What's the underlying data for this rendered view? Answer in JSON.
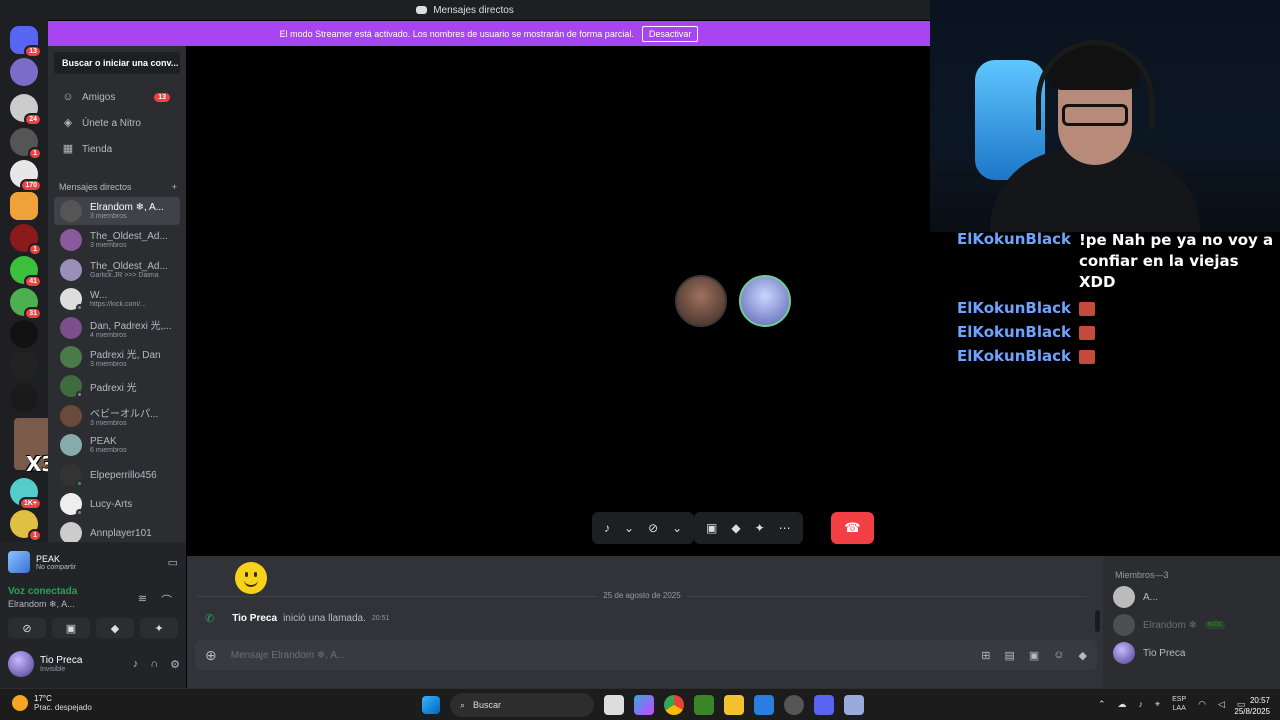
{
  "window": {
    "title": "Mensajes directos"
  },
  "banner": {
    "text": "El modo Streamer está activado. Los nombres de usuario se mostrarán de forma parcial.",
    "button": "Desactivar"
  },
  "rail": {
    "badges": [
      "13",
      "24",
      "1",
      "170",
      "1",
      "41",
      "31",
      "1K+",
      "1"
    ],
    "overlay_label": "X3"
  },
  "sidebar": {
    "search_placeholder": "Buscar o iniciar una conv...",
    "nav": [
      {
        "label": "Amigos",
        "count": "13"
      },
      {
        "label": "Únete a Nitro"
      },
      {
        "label": "Tienda"
      }
    ],
    "dm_header": "Mensajes directos",
    "dms": [
      {
        "name": "Elrandom ❄, A...",
        "sub": "3 miembros"
      },
      {
        "name": "The_Oldest_Ad...",
        "sub": "3 miembros"
      },
      {
        "name": "The_Oldest_Ad...",
        "sub": "Garlick.JR >>> Daima"
      },
      {
        "name": "W...",
        "sub": "https://kick.com/..."
      },
      {
        "name": "Dan, Padrexi 光,...",
        "sub": "4 miembros"
      },
      {
        "name": "Padrexi 光, Dan",
        "sub": "3 miembros"
      },
      {
        "name": "Padrexi 光",
        "sub": ""
      },
      {
        "name": "ベビーオルパ...",
        "sub": "3 miembros"
      },
      {
        "name": "PEAK",
        "sub": "6 miembros"
      },
      {
        "name": "Elpeperrillo456",
        "sub": ""
      },
      {
        "name": "Lucy-Arts",
        "sub": ""
      },
      {
        "name": "Annplayer101",
        "sub": ""
      }
    ]
  },
  "activity": {
    "game": "PEAK",
    "status": "No compartir"
  },
  "voice": {
    "status": "Voz conectada",
    "channel": "Elrandom ❄, A..."
  },
  "user": {
    "name": "Tio Preca",
    "status": "Invisible"
  },
  "chat": {
    "date": "25 de agosto de 2025",
    "call_user": "Tio Preca",
    "call_text": "inició una llamada.",
    "call_time": "20:51",
    "input_placeholder": "Mensaje Elrandom ❄, A..."
  },
  "members": {
    "header": "Miembros—3",
    "list": [
      {
        "name": "A...",
        "badge": ""
      },
      {
        "name": "Elrandom ❄",
        "badge": "KICK"
      },
      {
        "name": "Tio Preca",
        "badge": ""
      }
    ]
  },
  "overlay_chat": [
    {
      "user": "ElKokunBlack",
      "msg": "!pe Nah pe ya no voy a confiar en la viejas XDD"
    },
    {
      "user": "ElKokunBlack",
      "msg": ""
    },
    {
      "user": "ElKokunBlack",
      "msg": ""
    },
    {
      "user": "ElKokunBlack",
      "msg": ""
    }
  ],
  "taskbar": {
    "temp": "17°C",
    "weather": "Prac. despejado",
    "search": "Buscar",
    "lang1": "ESP",
    "lang2": "LAA",
    "time": "20:57",
    "date": "25/8/2025"
  },
  "colors": {
    "accent_purple": "#a844f0",
    "danger": "#f23f43",
    "online": "#23a55a",
    "overlay_user": "#6fa3ff"
  }
}
